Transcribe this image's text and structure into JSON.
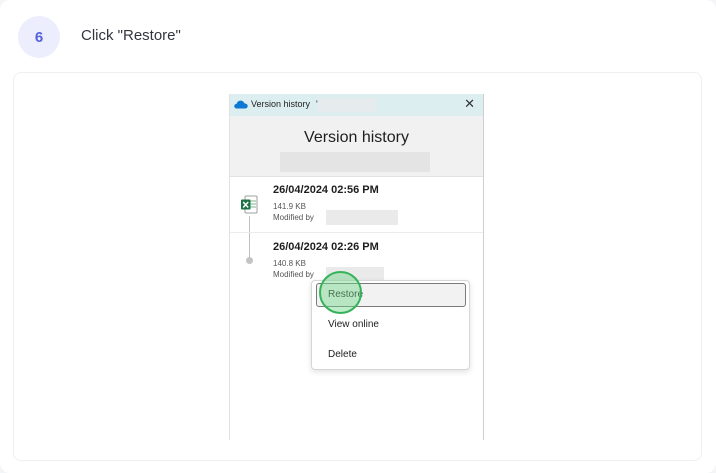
{
  "step": {
    "number": "6",
    "instruction": "Click \"Restore\""
  },
  "window": {
    "title": "Version history",
    "title_suffix": "'",
    "heading": "Version history",
    "close_glyph": "✕"
  },
  "versions": [
    {
      "date": "26/04/2024 02:56 PM",
      "size": "141.9 KB",
      "modified_label": "Modified by"
    },
    {
      "date": "26/04/2024 02:26 PM",
      "size": "140.8 KB",
      "modified_label": "Modified by"
    }
  ],
  "context_menu": {
    "items": [
      {
        "label": "Restore"
      },
      {
        "label": "View online"
      },
      {
        "label": "Delete"
      }
    ]
  },
  "colors": {
    "accent": "#5561d8",
    "click_marker": "#35b35a",
    "excel": "#1e7145",
    "onedrive": "#0f78d4"
  },
  "icons": [
    "onedrive-cloud-icon",
    "close-icon",
    "excel-file-icon"
  ]
}
